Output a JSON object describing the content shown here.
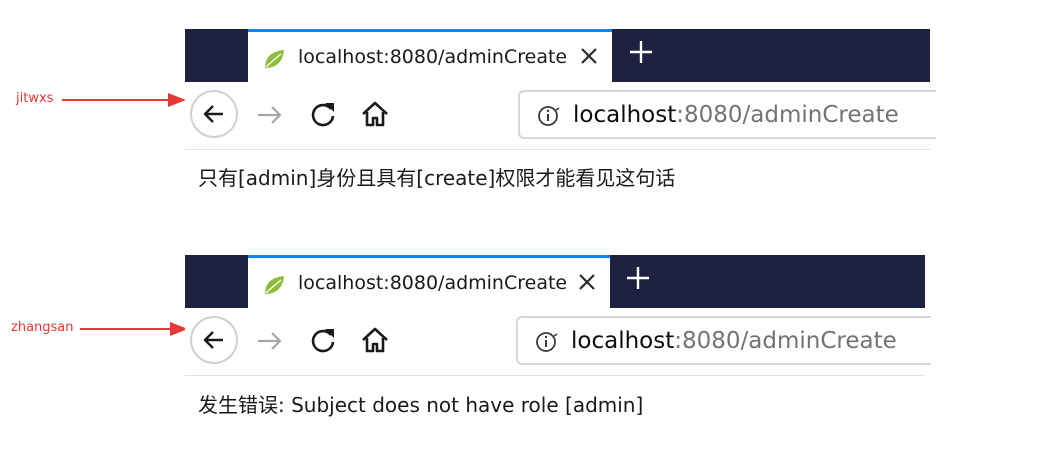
{
  "annotations": [
    {
      "user": "jitwxs"
    },
    {
      "user": "zhangsan"
    }
  ],
  "browsers": [
    {
      "tab_title": "localhost:8080/adminCreate",
      "url_host": "localhost",
      "url_rest": ":8080/adminCreate",
      "page_text": "只有[admin]身份且具有[create]权限才能看见这句话"
    },
    {
      "tab_title": "localhost:8080/adminCreate",
      "url_host": "localhost",
      "url_rest": ":8080/adminCreate",
      "page_text": "发生错误: Subject does not have role [admin]"
    }
  ],
  "colors": {
    "annotation": "#e53935",
    "tabstrip": "#1f2140",
    "tab_accent": "#0a84ff"
  },
  "icons": [
    "spring-leaf-icon",
    "close-icon",
    "plus-icon",
    "back-arrow-icon",
    "forward-arrow-icon",
    "reload-icon",
    "home-icon",
    "info-icon"
  ]
}
